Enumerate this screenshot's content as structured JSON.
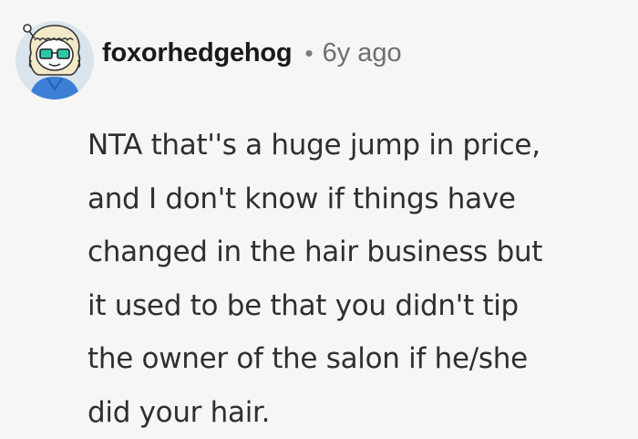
{
  "comment": {
    "author": {
      "username": "foxorhedgehog",
      "avatar_icon": "snoo-avatar-icon"
    },
    "separator": "•",
    "timestamp": "6y ago",
    "body_lines": [
      "NTA that''s a huge jump in price,",
      "and I don't know if things have",
      "changed in the hair business but",
      "it used to be that you didn't tip",
      "the owner of the salon if he/she",
      "did your hair."
    ]
  },
  "colors": {
    "background": "#f7f6f5",
    "avatar_bg": "#d9e4ec",
    "text": "#2f2f2f",
    "username": "#1a1a1b",
    "meta": "#6f6f6f"
  }
}
